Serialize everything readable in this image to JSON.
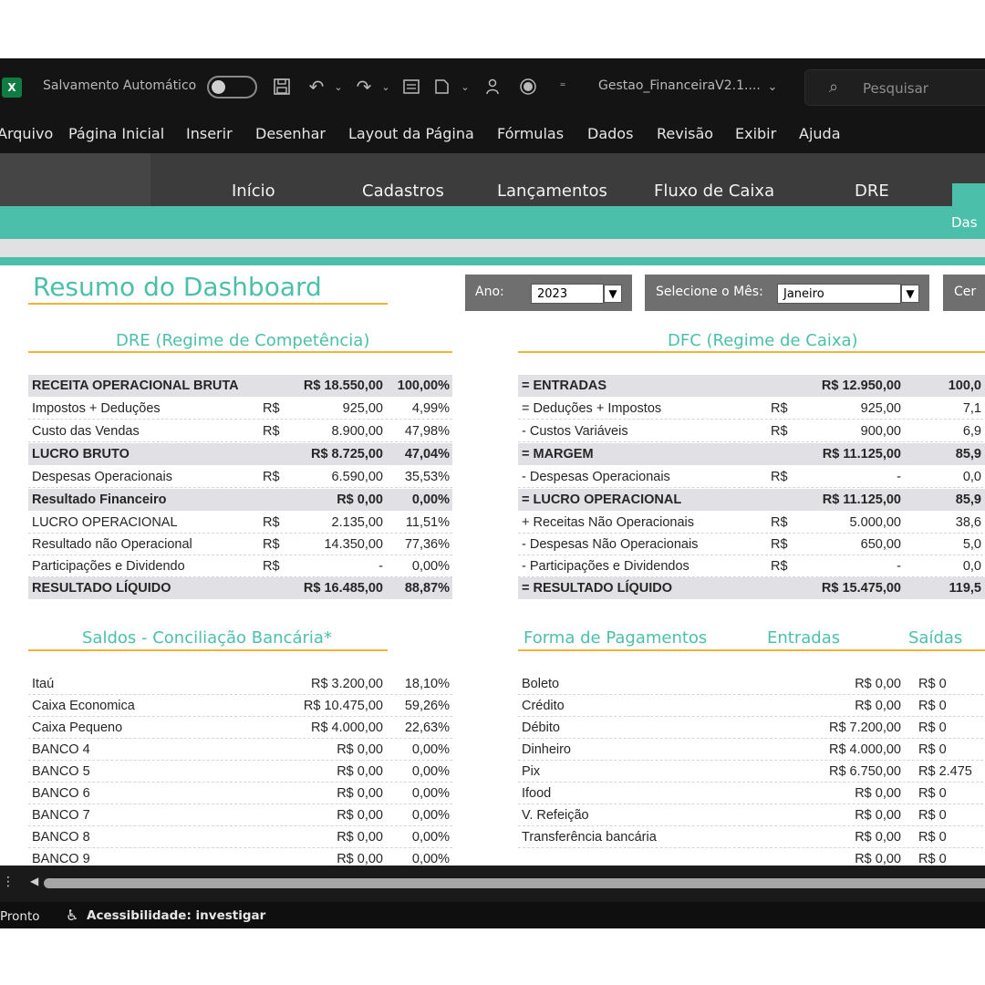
{
  "titlebar": {
    "autosave_label": "Salvamento Automático",
    "filename": "Gestao_FinanceiraV2.1....",
    "search_placeholder": "Pesquisar"
  },
  "menu": [
    "Arquivo",
    "Página Inicial",
    "Inserir",
    "Desenhar",
    "Layout da Página",
    "Fórmulas",
    "Dados",
    "Revisão",
    "Exibir",
    "Ajuda"
  ],
  "nav": {
    "items": [
      "Início",
      "Cadastros",
      "Lançamentos",
      "Fluxo de Caixa",
      "DRE"
    ],
    "active_label": "Das"
  },
  "dashboard": {
    "title": "Resumo do Dashboard",
    "filters": {
      "year_label": "Ano:",
      "year_value": "2023",
      "month_label": "Selecione o Mês:",
      "month_value": "Janeiro",
      "extra_label": "Cer"
    },
    "dre": {
      "title": "DRE (Regime de Competência)",
      "rows": [
        {
          "name": "RECEITA OPERACIONAL BRUTA",
          "cur": "",
          "value": "R$ 18.550,00",
          "pct": "100,00%",
          "bold": true
        },
        {
          "name": "Impostos + Deduções",
          "cur": "R$",
          "value": "925,00",
          "pct": "4,99%",
          "bold": false
        },
        {
          "name": "Custo das Vendas",
          "cur": "R$",
          "value": "8.900,00",
          "pct": "47,98%",
          "bold": false
        },
        {
          "name": "LUCRO BRUTO",
          "cur": "",
          "value": "R$ 8.725,00",
          "pct": "47,04%",
          "bold": true
        },
        {
          "name": "Despesas Operacionais",
          "cur": "R$",
          "value": "6.590,00",
          "pct": "35,53%",
          "bold": false
        },
        {
          "name": "Resultado Financeiro",
          "cur": "",
          "value": "R$ 0,00",
          "pct": "0,00%",
          "bold": true
        },
        {
          "name": "LUCRO OPERACIONAL",
          "cur": "R$",
          "value": "2.135,00",
          "pct": "11,51%",
          "bold": false
        },
        {
          "name": "Resultado não Operacional",
          "cur": "R$",
          "value": "14.350,00",
          "pct": "77,36%",
          "bold": false
        },
        {
          "name": "Participações e Dividendo",
          "cur": "R$",
          "value": "-",
          "pct": "0,00%",
          "bold": false
        },
        {
          "name": "RESULTADO LÍQUIDO",
          "cur": "",
          "value": "R$ 16.485,00",
          "pct": "88,87%",
          "bold": true
        }
      ]
    },
    "dfc": {
      "title": "DFC (Regime de Caixa)",
      "rows": [
        {
          "name": "= ENTRADAS",
          "cur": "",
          "value": "R$ 12.950,00",
          "pct": "100,0",
          "bold": true
        },
        {
          "name": "= Deduções + Impostos",
          "cur": "R$",
          "value": "925,00",
          "pct": "7,1",
          "bold": false
        },
        {
          "name": "- Custos Variáveis",
          "cur": "R$",
          "value": "900,00",
          "pct": "6,9",
          "bold": false
        },
        {
          "name": "= MARGEM",
          "cur": "",
          "value": "R$ 11.125,00",
          "pct": "85,9",
          "bold": true
        },
        {
          "name": "- Despesas Operacionais",
          "cur": "R$",
          "value": "-",
          "pct": "0,0",
          "bold": false
        },
        {
          "name": "= LUCRO OPERACIONAL",
          "cur": "",
          "value": "R$ 11.125,00",
          "pct": "85,9",
          "bold": true
        },
        {
          "name": "+ Receitas Não Operacionais",
          "cur": "R$",
          "value": "5.000,00",
          "pct": "38,6",
          "bold": false
        },
        {
          "name": "- Despesas Não Operacionais",
          "cur": "R$",
          "value": "650,00",
          "pct": "5,0",
          "bold": false
        },
        {
          "name": "- Participações e Dividendos",
          "cur": "R$",
          "value": "-",
          "pct": "0,0",
          "bold": false
        },
        {
          "name": "= RESULTADO LÍQUIDO",
          "cur": "",
          "value": "R$ 15.475,00",
          "pct": "119,5",
          "bold": true
        }
      ]
    },
    "saldos": {
      "title": "Saldos - Conciliação Bancária*",
      "rows": [
        {
          "name": "Itaú",
          "value": "R$ 3.200,00",
          "pct": "18,10%"
        },
        {
          "name": "Caixa Economica",
          "value": "R$ 10.475,00",
          "pct": "59,26%"
        },
        {
          "name": "Caixa Pequeno",
          "value": "R$ 4.000,00",
          "pct": "22,63%"
        },
        {
          "name": "BANCO 4",
          "value": "R$ 0,00",
          "pct": "0,00%"
        },
        {
          "name": "BANCO 5",
          "value": "R$ 0,00",
          "pct": "0,00%"
        },
        {
          "name": "BANCO 6",
          "value": "R$ 0,00",
          "pct": "0,00%"
        },
        {
          "name": "BANCO 7",
          "value": "R$ 0,00",
          "pct": "0,00%"
        },
        {
          "name": "BANCO 8",
          "value": "R$ 0,00",
          "pct": "0,00%"
        },
        {
          "name": "BANCO 9",
          "value": "R$ 0,00",
          "pct": "0,00%"
        }
      ]
    },
    "pagamentos": {
      "title": "Forma de Pagamentos",
      "col_in": "Entradas",
      "col_out": "Saídas",
      "rows": [
        {
          "name": "Boleto",
          "in": "R$ 0,00",
          "out": "R$ 0"
        },
        {
          "name": "Crédito",
          "in": "R$ 0,00",
          "out": "R$ 0"
        },
        {
          "name": "Débito",
          "in": "R$ 7.200,00",
          "out": "R$ 0"
        },
        {
          "name": "Dinheiro",
          "in": "R$ 4.000,00",
          "out": "R$ 0"
        },
        {
          "name": "Pix",
          "in": "R$ 6.750,00",
          "out": "R$ 2.475"
        },
        {
          "name": "Ifood",
          "in": "R$ 0,00",
          "out": "R$ 0"
        },
        {
          "name": "V. Refeição",
          "in": "R$ 0,00",
          "out": "R$ 0"
        },
        {
          "name": "Transferência bancária",
          "in": "R$ 0,00",
          "out": "R$ 0"
        },
        {
          "name": "",
          "in": "R$ 0,00",
          "out": "R$ 0"
        }
      ]
    }
  },
  "status": {
    "ready": "Pronto",
    "accessibility": "Acessibilidade: investigar"
  },
  "colors": {
    "accent": "#4cbfab",
    "underline": "#f2b233",
    "header_row": "#e1e1e5",
    "chrome": "#141414"
  },
  "icons": [
    "excel-logo-icon",
    "save-icon",
    "undo-icon",
    "redo-icon",
    "form-icon",
    "format-icon",
    "person-icon",
    "record-icon",
    "customize-icon",
    "chevron-down-icon",
    "search-icon",
    "accessibility-icon",
    "scroll-left-icon"
  ]
}
